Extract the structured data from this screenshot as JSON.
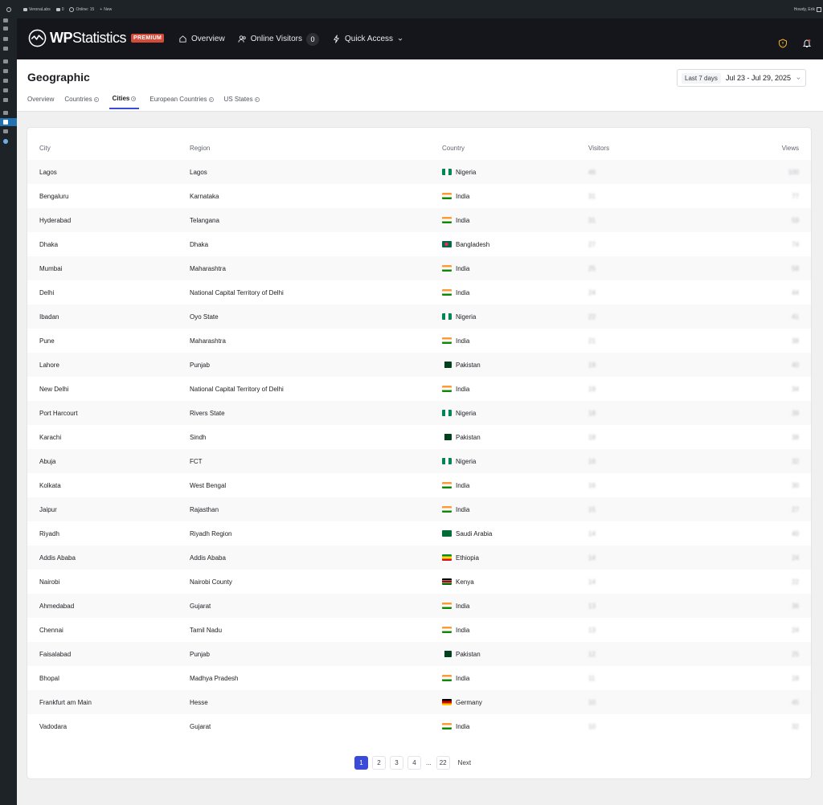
{
  "adminbar": {
    "site_name": "VeronaLabs",
    "comments_count": "0",
    "online_label": "Online: 15",
    "new_label": "New",
    "howdy": "Howdy, Erik"
  },
  "header": {
    "logo_bold": "WP",
    "logo_light": "Statistics",
    "badge": "PREMIUM",
    "nav_overview": "Overview",
    "nav_online_visitors": "Online Visitors",
    "online_count": "0",
    "nav_quick_access": "Quick Access"
  },
  "subheader": {
    "title": "Geographic",
    "date_preset": "Last 7 days",
    "date_range": "Jul 23 - Jul 29, 2025",
    "tabs": [
      {
        "label": "Overview"
      },
      {
        "label": "Countries"
      },
      {
        "label": "Cities"
      },
      {
        "label": "European Countries"
      },
      {
        "label": "US States"
      }
    ]
  },
  "table": {
    "columns": {
      "city": "City",
      "region": "Region",
      "country": "Country",
      "visitors": "Visitors",
      "views": "Views"
    },
    "rows": [
      {
        "city": "Lagos",
        "region": "Lagos",
        "country": "Nigeria",
        "flag": "ng",
        "visitors": "46",
        "views": "100"
      },
      {
        "city": "Bengaluru",
        "region": "Karnataka",
        "country": "India",
        "flag": "in",
        "visitors": "31",
        "views": "77"
      },
      {
        "city": "Hyderabad",
        "region": "Telangana",
        "country": "India",
        "flag": "in",
        "visitors": "31",
        "views": "59"
      },
      {
        "city": "Dhaka",
        "region": "Dhaka",
        "country": "Bangladesh",
        "flag": "bd",
        "visitors": "27",
        "views": "74"
      },
      {
        "city": "Mumbai",
        "region": "Maharashtra",
        "country": "India",
        "flag": "in",
        "visitors": "25",
        "views": "58"
      },
      {
        "city": "Delhi",
        "region": "National Capital Territory of Delhi",
        "country": "India",
        "flag": "in",
        "visitors": "24",
        "views": "44"
      },
      {
        "city": "Ibadan",
        "region": "Oyo State",
        "country": "Nigeria",
        "flag": "ng",
        "visitors": "22",
        "views": "41"
      },
      {
        "city": "Pune",
        "region": "Maharashtra",
        "country": "India",
        "flag": "in",
        "visitors": "21",
        "views": "38"
      },
      {
        "city": "Lahore",
        "region": "Punjab",
        "country": "Pakistan",
        "flag": "pk",
        "visitors": "19",
        "views": "40"
      },
      {
        "city": "New Delhi",
        "region": "National Capital Territory of Delhi",
        "country": "India",
        "flag": "in",
        "visitors": "19",
        "views": "34"
      },
      {
        "city": "Port Harcourt",
        "region": "Rivers State",
        "country": "Nigeria",
        "flag": "ng",
        "visitors": "18",
        "views": "39"
      },
      {
        "city": "Karachi",
        "region": "Sindh",
        "country": "Pakistan",
        "flag": "pk",
        "visitors": "18",
        "views": "38"
      },
      {
        "city": "Abuja",
        "region": "FCT",
        "country": "Nigeria",
        "flag": "ng",
        "visitors": "16",
        "views": "32"
      },
      {
        "city": "Kolkata",
        "region": "West Bengal",
        "country": "India",
        "flag": "in",
        "visitors": "16",
        "views": "30"
      },
      {
        "city": "Jaipur",
        "region": "Rajasthan",
        "country": "India",
        "flag": "in",
        "visitors": "15",
        "views": "27"
      },
      {
        "city": "Riyadh",
        "region": "Riyadh Region",
        "country": "Saudi Arabia",
        "flag": "sa",
        "visitors": "14",
        "views": "40"
      },
      {
        "city": "Addis Ababa",
        "region": "Addis Ababa",
        "country": "Ethiopia",
        "flag": "et",
        "visitors": "14",
        "views": "24"
      },
      {
        "city": "Nairobi",
        "region": "Nairobi County",
        "country": "Kenya",
        "flag": "ke",
        "visitors": "14",
        "views": "22"
      },
      {
        "city": "Ahmedabad",
        "region": "Gujarat",
        "country": "India",
        "flag": "in",
        "visitors": "13",
        "views": "36"
      },
      {
        "city": "Chennai",
        "region": "Tamil Nadu",
        "country": "India",
        "flag": "in",
        "visitors": "13",
        "views": "24"
      },
      {
        "city": "Faisalabad",
        "region": "Punjab",
        "country": "Pakistan",
        "flag": "pk",
        "visitors": "12",
        "views": "25"
      },
      {
        "city": "Bhopal",
        "region": "Madhya Pradesh",
        "country": "India",
        "flag": "in",
        "visitors": "11",
        "views": "18"
      },
      {
        "city": "Frankfurt am Main",
        "region": "Hesse",
        "country": "Germany",
        "flag": "de",
        "visitors": "10",
        "views": "45"
      },
      {
        "city": "Vadodara",
        "region": "Gujarat",
        "country": "India",
        "flag": "in",
        "visitors": "10",
        "views": "32"
      }
    ]
  },
  "pagination": {
    "pages": [
      "1",
      "2",
      "3",
      "4"
    ],
    "ellipsis": "...",
    "last": "22",
    "next": "Next",
    "current": "1"
  },
  "colors": {
    "accent": "#3b4bd8",
    "header_bg": "#15161c",
    "badge": "#d14c3a"
  }
}
